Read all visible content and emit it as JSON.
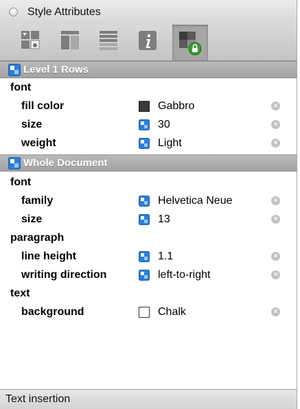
{
  "window": {
    "title": "Style Attributes"
  },
  "toolbar": {
    "buttons": [
      {
        "icon": "styles-grid-icon"
      },
      {
        "icon": "columns-icon"
      },
      {
        "icon": "rows-icon"
      },
      {
        "icon": "info-icon"
      },
      {
        "icon": "locked-style-icon",
        "active": true
      }
    ]
  },
  "sections": [
    {
      "label": "Level 1 Rows",
      "groups": [
        {
          "name": "font",
          "attributes": [
            {
              "label": "fill color",
              "value": "Gabbro",
              "swatch": "#3a3a3a"
            },
            {
              "label": "size",
              "value": "30",
              "swatch": "style-icon"
            },
            {
              "label": "weight",
              "value": "Light",
              "swatch": "style-icon"
            }
          ]
        }
      ]
    },
    {
      "label": "Whole Document",
      "groups": [
        {
          "name": "font",
          "attributes": [
            {
              "label": "family",
              "value": "Helvetica Neue",
              "swatch": "style-icon"
            },
            {
              "label": "size",
              "value": "13",
              "swatch": "style-icon"
            }
          ]
        },
        {
          "name": "paragraph",
          "attributes": [
            {
              "label": "line height",
              "value": "1.1",
              "swatch": "style-icon"
            },
            {
              "label": "writing direction",
              "value": "left-to-right",
              "swatch": "style-icon"
            }
          ]
        },
        {
          "name": "text",
          "attributes": [
            {
              "label": "background",
              "value": "Chalk",
              "swatch": "#ffffff"
            }
          ]
        }
      ]
    }
  ],
  "status": {
    "text": "Text insertion"
  },
  "colors": {
    "accent_blue": "#2d7fd6",
    "header_gray": "#aaaaaa"
  }
}
